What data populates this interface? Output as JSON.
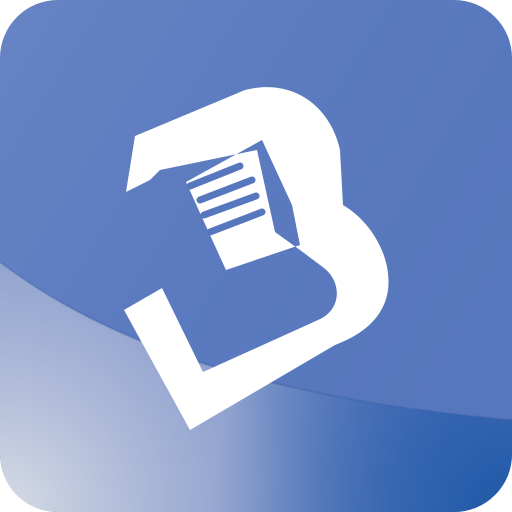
{
  "app_icon": {
    "icon_name": "document-b-logo-icon",
    "colors": {
      "base": "#5676bd",
      "shine_light": "#d9dde6",
      "deep_blue": "#1f59a8",
      "logo": "#ffffff"
    }
  }
}
